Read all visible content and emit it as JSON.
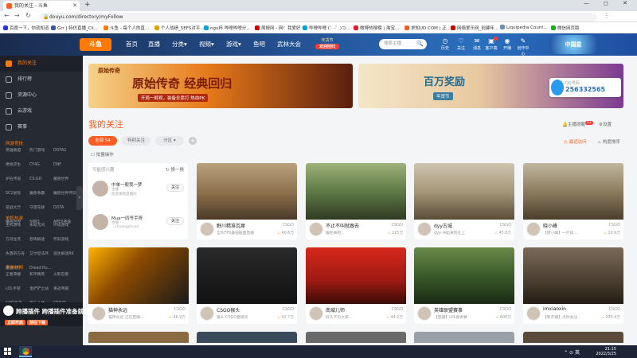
{
  "browser": {
    "tab_title": "我的关注 - 斗鱼",
    "url": "douyu.com/directory/myFollow",
    "new_tab": "+",
    "window_controls": "— ◻ ✕"
  },
  "bookmarks": [
    {
      "label": "百度一下，你就知道",
      "color": "#2932e1"
    },
    {
      "label": "Grr | 特仿直播_Cli...",
      "color": "#3b5998"
    },
    {
      "label": "斗鱼 - 每个人的直...",
      "color": "#ff7a00"
    },
    {
      "label": "个人战绩_5EFS对平...",
      "color": "#e0a000"
    },
    {
      "label": "ngu杯 哔哩哔哩分...",
      "color": "#00a1d6"
    },
    {
      "label": "周报网 - 网！我爱好",
      "color": "#c00"
    },
    {
      "label": "哔哩哔哩 (゜-゜)つ...",
      "color": "#00a1d6"
    },
    {
      "label": "微博热搜榜 | 淘宝...",
      "color": "#e6162d"
    },
    {
      "label": "求知UD.COM | 正...",
      "color": "#ff5d23"
    },
    {
      "label": "网络爱乐网_创建年...",
      "color": "#c00"
    },
    {
      "label": "Liquipedia Count...",
      "color": "#6b8eb5"
    },
    {
      "label": "微信网页版",
      "color": "#1aad19"
    }
  ],
  "header": {
    "logo": "斗鱼",
    "nav": [
      "首页",
      "直播",
      "分类▾",
      "视频▾",
      "游戏▾",
      "鱼吧",
      "武林大会"
    ],
    "promo_top": "年货节",
    "promo_badge": "欢迎回归",
    "search_placeholder": "搜索主播",
    "search_icon": "🔍",
    "icons": [
      {
        "label": "历史",
        "glyph": "◷",
        "dot": false
      },
      {
        "label": "关注",
        "glyph": "♡",
        "dot": false
      },
      {
        "label": "消息",
        "glyph": "✉",
        "dot": false
      },
      {
        "label": "客户端",
        "glyph": "▣",
        "dot": true
      },
      {
        "label": "开播",
        "glyph": "◉",
        "dot": false
      },
      {
        "label": "创作中心",
        "glyph": "✎",
        "dot": false
      }
    ],
    "art_text": "中国星"
  },
  "sidebar": {
    "items": [
      {
        "label": "我的关注",
        "active": true
      },
      {
        "label": "排行榜",
        "active": false
      },
      {
        "label": "资源中心",
        "active": false
      },
      {
        "label": "云游戏",
        "active": false
      },
      {
        "label": "赛事",
        "active": false
      }
    ],
    "cat_online": "网游竞技",
    "online_games": [
      "英雄联盟",
      "热门游戏",
      "DOTA2",
      "绝地求生",
      "CF4G",
      "DNF",
      "炉石传说",
      "CS:GO",
      "魔兽世界",
      "SC2星际",
      "魔兽争霸",
      "魔兽世界怀旧",
      "逆战大厅",
      "守望先锋",
      "DOTA",
      "魔兽世界",
      "剑网3",
      "APEX英雄"
    ],
    "cat_single": "单机热游",
    "single_games": [
      "主机游戏",
      "永劫无间",
      "环境游戏",
      "方舟生存",
      "恐怖解谜",
      "怀旧游戏",
      "失落的方舟",
      "艾尔登法环",
      "逃生解谜RK",
      "魔兽大厅",
      "Dread Hu..."
    ],
    "cat_mobile": "手游休闲",
    "mobile_games": [
      "王者荣耀",
      "和平精英",
      "火影忍者",
      "LOL手游",
      "金铲铲之战",
      "重返帝国",
      "COD手游",
      "第五人格",
      "CF手游"
    ],
    "collapse_glyph": "‹"
  },
  "plugin": {
    "text": "跨播插件 跨播插件准备就绪",
    "btn1": "立即开启",
    "btn2": "前往下载"
  },
  "banners": {
    "b1_title": "原始传奇 经典回归",
    "b1_sub": "开局一裤衩，装备全靠打 热血PK",
    "b1_logo": "原始传奇",
    "b2_title": "百万奖励",
    "b2_sub": "年货节"
  },
  "qq_bubble": {
    "line1": "QQ号码",
    "line2": "256332565"
  },
  "follow": {
    "title": "我的关注",
    "notice": "主播提醒",
    "notice_badge": "13",
    "settings": "设置",
    "tabs": [
      {
        "label": "全部 54",
        "active": true
      },
      {
        "label": "特别关注",
        "active": false
      },
      {
        "label": "分区 ▾",
        "active": false
      }
    ],
    "add_tab": "+",
    "batch": "批量操作",
    "sort_hot": "最近访问",
    "sort_rank": "热度排序"
  },
  "recommend": {
    "title": "可能感兴趣",
    "refresh": "换一换",
    "users": [
      {
        "name": "中单一般我一梦",
        "sub": "主播",
        "desc": "欢迎来我直播间",
        "btn": "关注"
      },
      {
        "name": "Mua一四爷手呀",
        "sub": "主播",
        "desc": "...shuangshuan",
        "btn": "关注"
      }
    ]
  },
  "cards": [
    {
      "title": "野川精准瓦犀",
      "cat": "CSGO",
      "status": "全队FPS最强截图直播",
      "pop": "40.6万",
      "thumb": "linear-gradient(180deg,#b9a27d 0%,#8b6e4a 55%,#4a3a2a 100%)"
    },
    {
      "title": "不止不叫就跟去",
      "cat": "CSGO",
      "status": "跟他来吧...",
      "pop": "215万",
      "thumb": "linear-gradient(180deg,#9fb27a 0%,#5f7a46 50%,#2f3b22 100%)"
    },
    {
      "title": "dyy古城",
      "cat": "CSGO",
      "status": "dyy-冲起来现在上",
      "pop": "45.0万",
      "thumb": "linear-gradient(180deg,#cfc5b0 0%,#a59779 50%,#5a4d38 100%)"
    },
    {
      "title": "晓小峰",
      "cat": "CSGO",
      "status": "【晓小峰】一叶知...",
      "pop": "10.9万",
      "thumb": "linear-gradient(180deg,#c0b7a0 0%,#8d7d60 50%,#4a3e2c 100%)"
    },
    {
      "title": "猫神永远",
      "cat": "CSGO",
      "status": "猫神永远 正在直播...",
      "pop": "46.9万",
      "thumb": "linear-gradient(135deg,#ffb300 0%,#8c4a00 40%,#1a1a1a 100%)"
    },
    {
      "title": "CSGO猴头",
      "cat": "CSGO",
      "status": "猴头 CSGO直播间",
      "pop": "42.7万",
      "thumb": "linear-gradient(180deg,#2a2a2a 0%,#111 100%)"
    },
    {
      "title": "南城儿师",
      "cat": "CSGO",
      "status": "好久不见大家...",
      "pop": "44.2万",
      "thumb": "linear-gradient(180deg,#d8281c 0%,#9c1a12 60%,#3a0a07 100%)"
    },
    {
      "title": "英雄联盟赛事",
      "cat": "CSGO",
      "status": "【直播】LPL春季赛",
      "pop": "600万",
      "thumb": "linear-gradient(180deg,#6a8a4a 0%,#3a5a2a 50%,#1a2a12 100%)"
    },
    {
      "title": "imxiaoxin",
      "cat": "CSGO",
      "status": "【新开播】点你关注...",
      "pop": "290.4万",
      "thumb": "linear-gradient(180deg,#7a6a58 0%,#4a3e30 60%,#221c14 100%)"
    }
  ],
  "taskbar": {
    "time": "21:15",
    "date": "2022/3/25",
    "tray": "⌃ ⊙ 英"
  }
}
